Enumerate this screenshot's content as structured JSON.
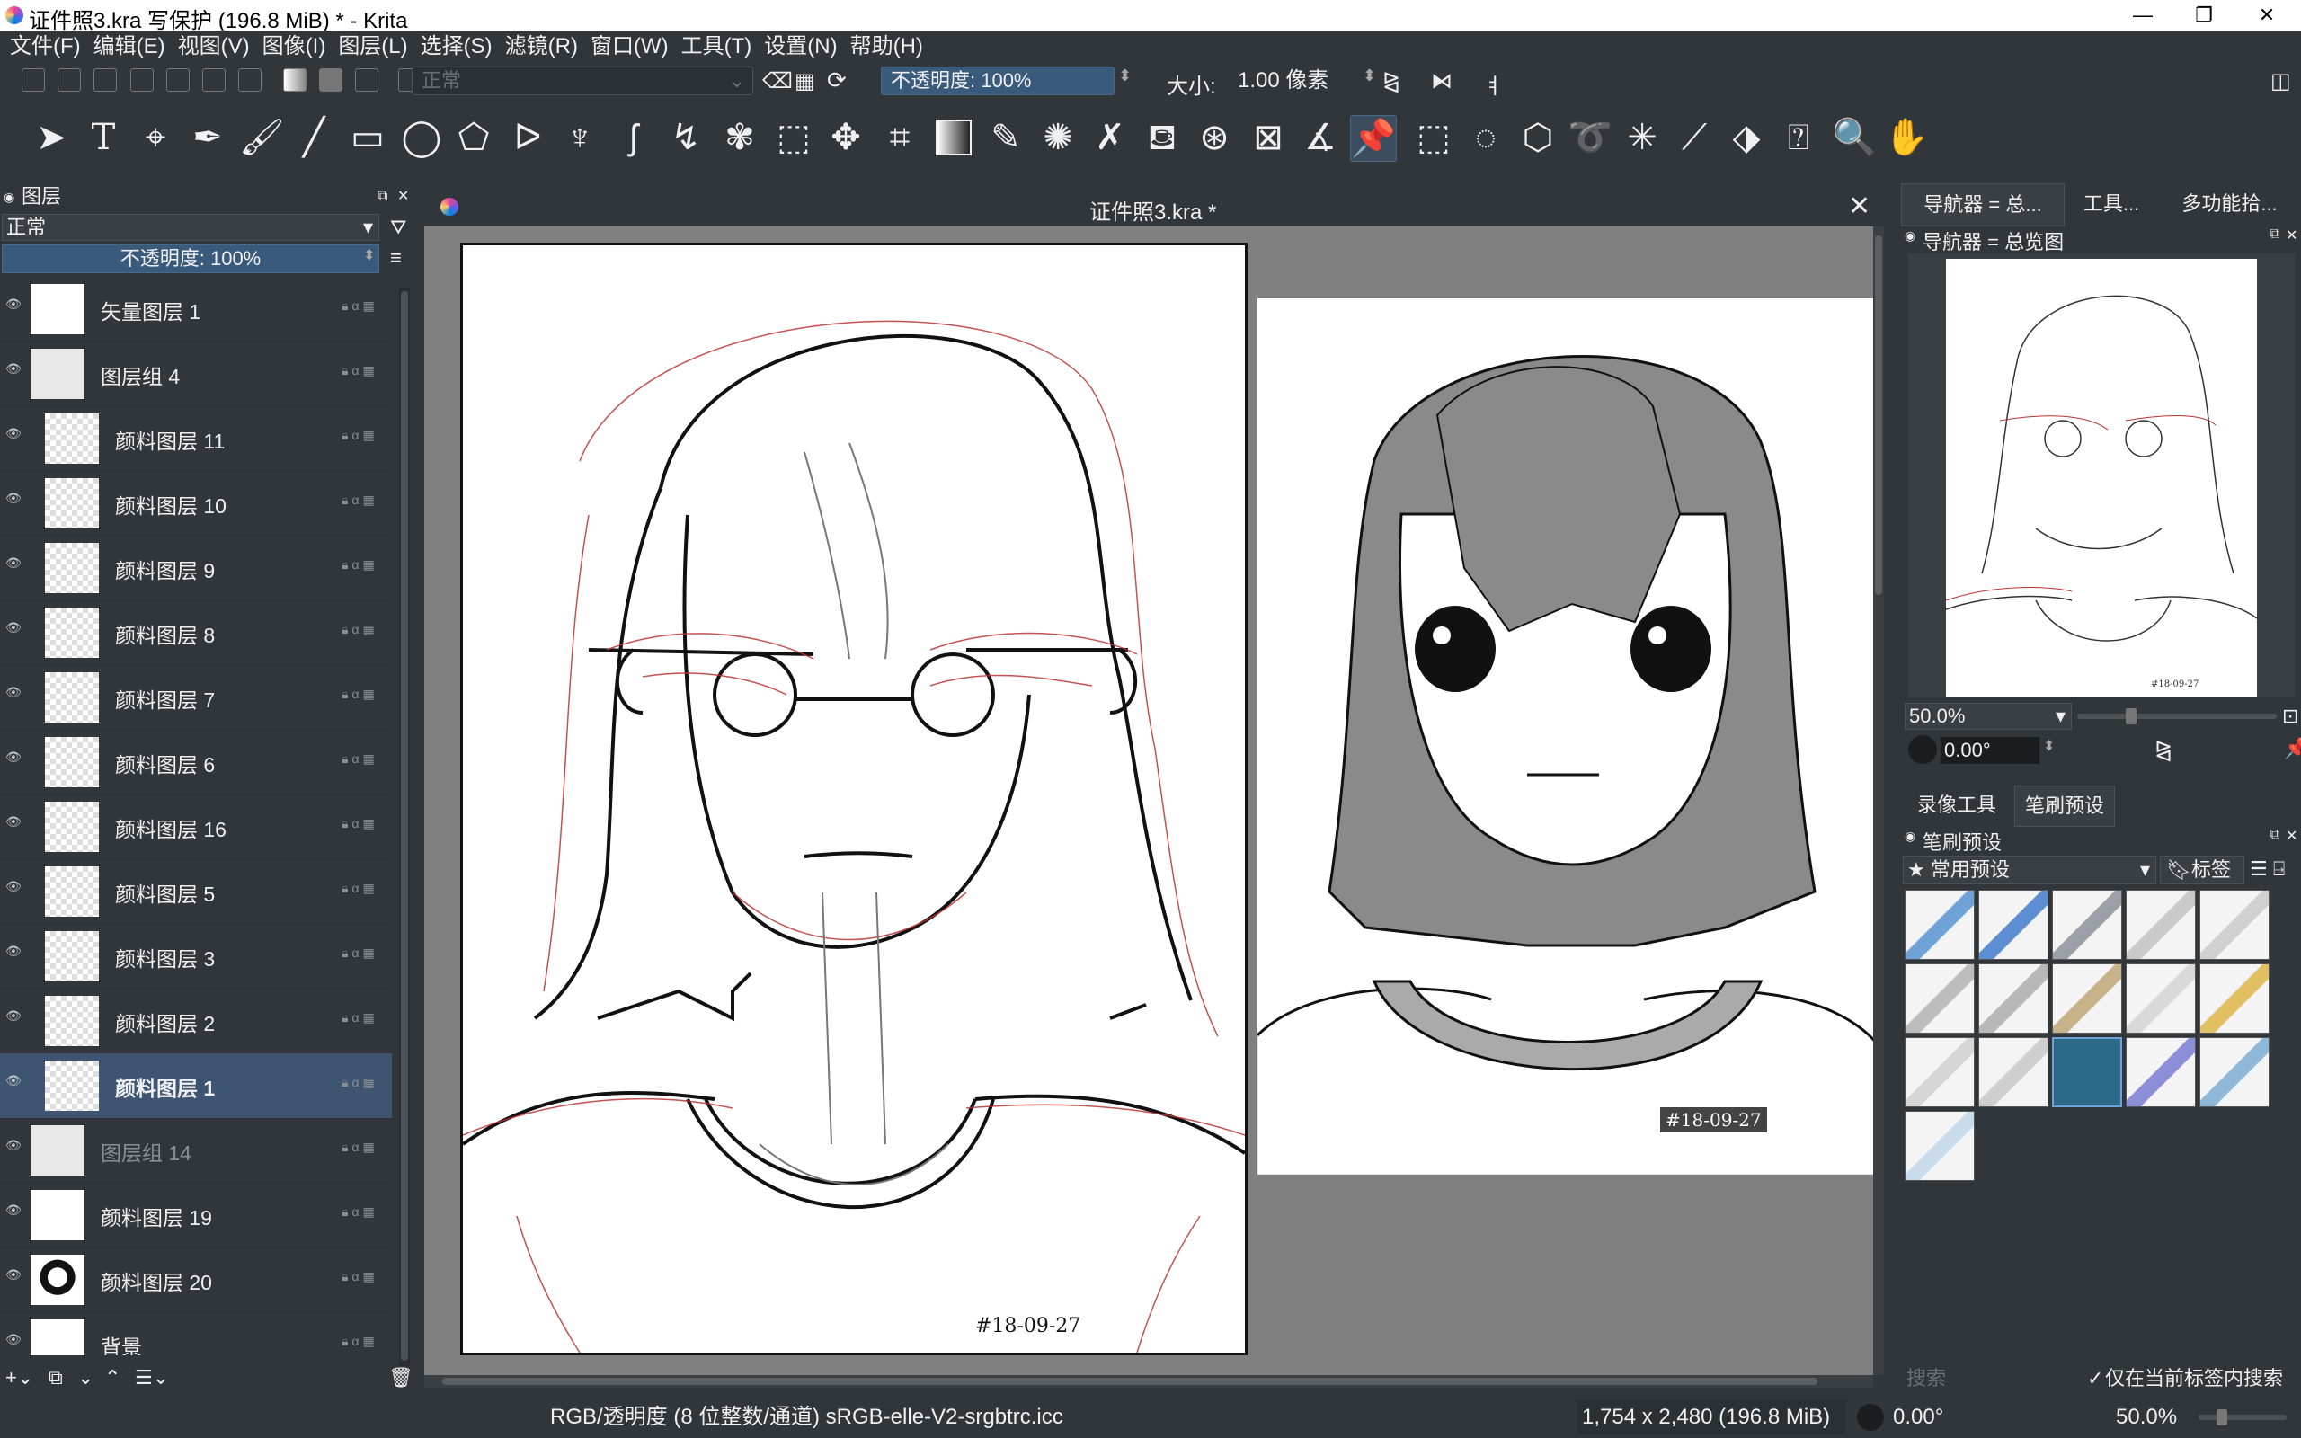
{
  "window": {
    "title": "证件照3.kra 写保护  (196.8 MiB)  * - Krita",
    "controls": [
      "—",
      "❐",
      "✕"
    ]
  },
  "menu": [
    "文件(F)",
    "编辑(E)",
    "视图(V)",
    "图像(I)",
    "图层(L)",
    "选择(S)",
    "滤镜(R)",
    "窗口(W)",
    "工具(T)",
    "设置(N)",
    "帮助(H)"
  ],
  "tool_options": {
    "blend_mode": "正常",
    "opacity_label": "不透明度:  100%",
    "size_label": "大小:",
    "size_value": "1.00 像素"
  },
  "layers_docker": {
    "title": "图层",
    "blend_mode": "正常",
    "opacity": "不透明度:  100%",
    "layers": [
      {
        "name": "矢量图层 1",
        "indent": 0,
        "thumb": "text"
      },
      {
        "name": "图层组 4",
        "indent": 0,
        "thumb": "group"
      },
      {
        "name": "颜料图层 11",
        "indent": 1,
        "thumb": "checker"
      },
      {
        "name": "颜料图层 10",
        "indent": 1,
        "thumb": "checker"
      },
      {
        "name": "颜料图层 9",
        "indent": 1,
        "thumb": "checker"
      },
      {
        "name": "颜料图层 8",
        "indent": 1,
        "thumb": "checker"
      },
      {
        "name": "颜料图层 7",
        "indent": 1,
        "thumb": "checker"
      },
      {
        "name": "颜料图层 6",
        "indent": 1,
        "thumb": "checker"
      },
      {
        "name": "颜料图层 16",
        "indent": 1,
        "thumb": "checker"
      },
      {
        "name": "颜料图层 5",
        "indent": 1,
        "thumb": "checker"
      },
      {
        "name": "颜料图层 3",
        "indent": 1,
        "thumb": "checker"
      },
      {
        "name": "颜料图层 2",
        "indent": 1,
        "thumb": "checker"
      },
      {
        "name": "颜料图层 1",
        "indent": 1,
        "thumb": "checker",
        "selected": true
      },
      {
        "name": "图层组 14",
        "indent": 0,
        "thumb": "group",
        "dim": true
      },
      {
        "name": "颜料图层 19",
        "indent": 0,
        "thumb": "white"
      },
      {
        "name": "颜料图层 20",
        "indent": 0,
        "thumb": "figure"
      },
      {
        "name": "背景",
        "indent": 0,
        "thumb": "white"
      }
    ]
  },
  "canvas": {
    "tab_title": "证件照3.kra *",
    "stamp_text": "#18-09-27",
    "ref_stamp_text": "#18-09-27"
  },
  "navigator": {
    "tabs": [
      "导航器 = 总...",
      "工具...",
      "多功能拾..."
    ],
    "title": "导航器 = 总览图",
    "zoom": "50.0%",
    "rotation": "0.00°",
    "thumb_stamp": "#18-09-27"
  },
  "brush_docker": {
    "tabs": [
      "录像工具",
      "笔刷预设"
    ],
    "title": "笔刷预设",
    "preset_group": "★ 常用预设",
    "tag_label": "标签",
    "search_placeholder": "搜索",
    "filter_checkbox": "仅在当前标签内搜索"
  },
  "status": {
    "color_space": "RGB/透明度 (8 位整数/通道)  sRGB-elle-V2-srgbtrc.icc",
    "dimensions": "1,754 x 2,480 (196.8 MiB)",
    "rotation": "0.00°",
    "zoom": "50.0%"
  }
}
